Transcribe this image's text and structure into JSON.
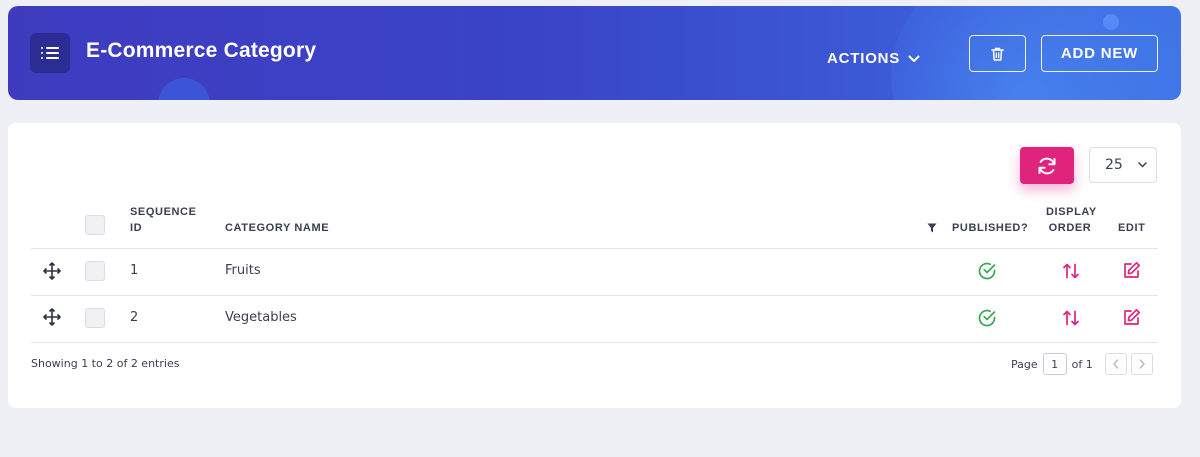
{
  "header": {
    "title": "E-Commerce Category",
    "actions_label": "ACTIONS",
    "add_new_label": "ADD NEW"
  },
  "toolbar": {
    "page_size": "25"
  },
  "table": {
    "columns": {
      "sequence_id_line1": "SEQUENCE",
      "sequence_id_line2": "ID",
      "category_name": "CATEGORY NAME",
      "published": "PUBLISHED?",
      "display_order_line1": "DISPLAY",
      "display_order_line2": "ORDER",
      "edit": "EDIT"
    },
    "rows": [
      {
        "sequence_id": "1",
        "category_name": "Fruits",
        "published": true
      },
      {
        "sequence_id": "2",
        "category_name": "Vegetables",
        "published": true
      }
    ]
  },
  "footer": {
    "showing": "Showing 1 to 2 of 2 entries",
    "page_label": "Page",
    "current_page": "1",
    "of_label": "of 1"
  },
  "colors": {
    "header_gradient_start": "#3f3bbf",
    "header_gradient_end": "#3f74e6",
    "accent_pink": "#e0247d",
    "published_green": "#3aa757"
  },
  "icons": {
    "menu": "menu-list-icon",
    "actions_caret": "chevron-down-icon",
    "delete": "trash-icon",
    "refresh": "refresh-icon",
    "move": "move-arrows-icon",
    "filter": "filter-icon",
    "published": "check-circle-icon",
    "display_order": "swap-vertical-icon",
    "edit": "edit-icon",
    "prev": "chevron-left-icon",
    "next": "chevron-right-icon"
  }
}
